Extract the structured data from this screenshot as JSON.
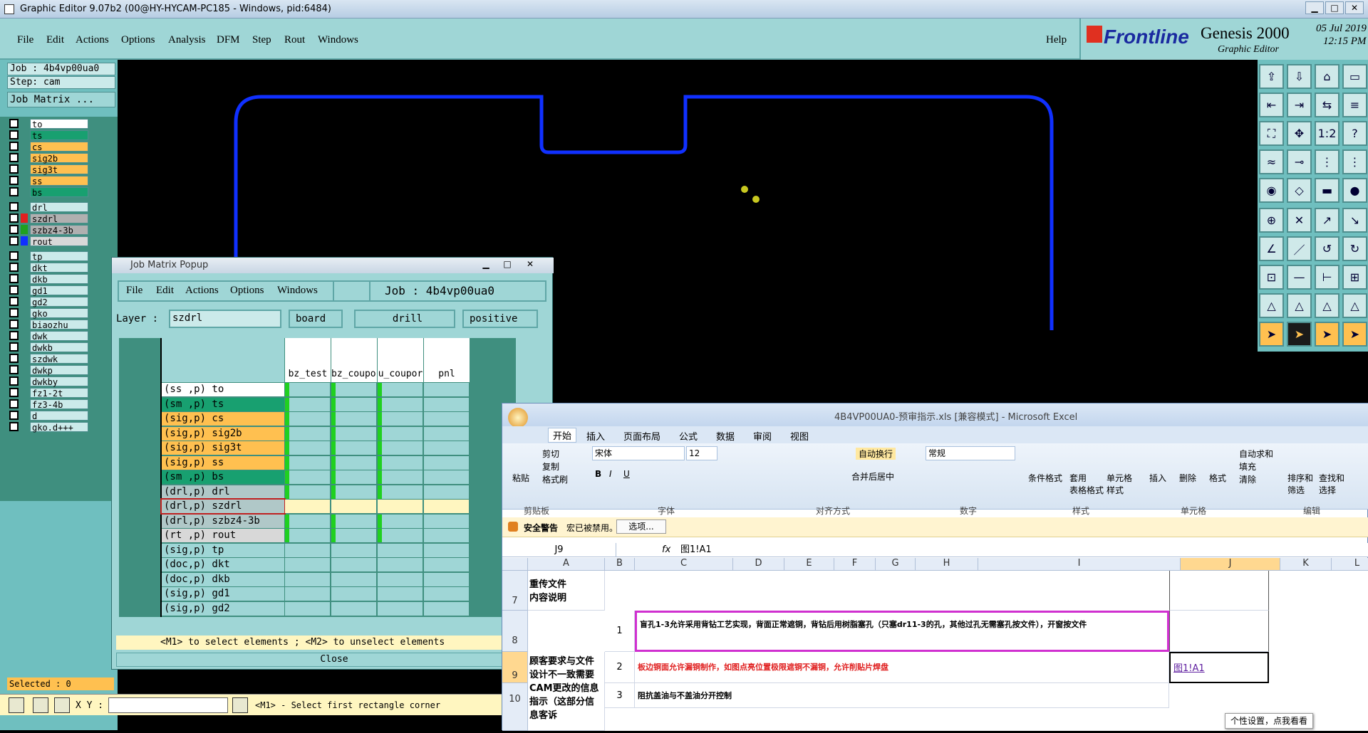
{
  "window_title": "Graphic Editor 9.07b2 (00@HY-HYCAM-PC185 - Windows, pid:6484)",
  "menu": [
    "File",
    "Edit",
    "Actions",
    "Options",
    "Analysis",
    "DFM",
    "Step",
    "Rout",
    "Windows"
  ],
  "help": "Help",
  "brand": {
    "frontline": "Frontline",
    "product": "Genesis 2000",
    "sub": "Graphic Editor",
    "date": "05 Jul 2019",
    "time": "12:15 PM"
  },
  "job_label": "Job : 4b4vp00ua0",
  "step_label": "Step: cam",
  "job_matrix_btn": "Job Matrix ...",
  "layers": [
    {
      "name": "to",
      "color": "#ffffff"
    },
    {
      "name": "ts",
      "color": "#18a070"
    },
    {
      "name": "cs",
      "color": "#ffc050"
    },
    {
      "name": "sig2b",
      "color": "#ffc050"
    },
    {
      "name": "sig3t",
      "color": "#ffc050"
    },
    {
      "name": "ss",
      "color": "#ffc050"
    },
    {
      "name": "bs",
      "color": "#18a070"
    },
    {
      "name": "drl",
      "color": "#cbeaea"
    },
    {
      "name": "szdrl",
      "color": "#b0b0b0"
    },
    {
      "name": "szbz4-3b",
      "color": "#b0b0b0"
    },
    {
      "name": "rout",
      "color": "#d8d8d8"
    },
    {
      "name": "tp",
      "color": "#cbeaea"
    },
    {
      "name": "dkt",
      "color": "#cbeaea"
    },
    {
      "name": "dkb",
      "color": "#cbeaea"
    },
    {
      "name": "gd1",
      "color": "#cbeaea"
    },
    {
      "name": "gd2",
      "color": "#cbeaea"
    },
    {
      "name": "gko",
      "color": "#cbeaea"
    },
    {
      "name": "biaozhu",
      "color": "#cbeaea"
    },
    {
      "name": "dwk",
      "color": "#cbeaea"
    },
    {
      "name": "dwkb",
      "color": "#cbeaea"
    },
    {
      "name": "szdwk",
      "color": "#cbeaea"
    },
    {
      "name": "dwkp",
      "color": "#cbeaea"
    },
    {
      "name": "dwkby",
      "color": "#cbeaea"
    },
    {
      "name": "fz1-2t",
      "color": "#cbeaea"
    },
    {
      "name": "fz3-4b",
      "color": "#cbeaea"
    },
    {
      "name": "d",
      "color": "#cbeaea"
    },
    {
      "name": "gko.d+++",
      "color": "#cbeaea"
    }
  ],
  "selected": "Selected : 0",
  "xy_label": "X Y :",
  "status_hint": "<M1> - Select first rectangle corner",
  "popup": {
    "title": "Job Matrix Popup",
    "menu": [
      "File",
      "Edit",
      "Actions",
      "Options",
      "Windows"
    ],
    "job": "Job : 4b4vp00ua0",
    "layer_label": "Layer :",
    "layer_value": "szdrl",
    "context": "board",
    "type": "drill",
    "polarity": "positive",
    "columns": [
      "bz_test",
      "bz_coupo:",
      "u_coupor",
      "pnl"
    ],
    "rows": [
      {
        "label": "(ss ,p) to",
        "color": "#ffffff"
      },
      {
        "label": "(sm ,p) ts",
        "color": "#18a070"
      },
      {
        "label": "(sig,p) cs",
        "color": "#ffc050"
      },
      {
        "label": "(sig,p) sig2b",
        "color": "#ffc050"
      },
      {
        "label": "(sig,p) sig3t",
        "color": "#ffc050"
      },
      {
        "label": "(sig,p) ss",
        "color": "#ffc050"
      },
      {
        "label": "(sm ,p) bs",
        "color": "#18a070"
      },
      {
        "label": "(drl,p) drl",
        "color": "#b0c8c8"
      },
      {
        "label": "(drl,p) szdrl",
        "color": "#b0c8c8"
      },
      {
        "label": "(drl,p) szbz4-3b",
        "color": "#b0c8c8"
      },
      {
        "label": "(rt ,p) rout",
        "color": "#d8d8d8"
      },
      {
        "label": "(sig,p) tp",
        "color": "#9fd6d6"
      },
      {
        "label": "(doc,p) dkt",
        "color": "#9fd6d6"
      },
      {
        "label": "(doc,p) dkb",
        "color": "#9fd6d6"
      },
      {
        "label": "(sig,p) gd1",
        "color": "#9fd6d6"
      },
      {
        "label": "(sig,p) gd2",
        "color": "#9fd6d6"
      }
    ],
    "hint": "<M1> to select elements ; <M2> to unselect elements",
    "close": "Close"
  },
  "excel": {
    "title": "4B4VP00UA0-预审指示.xls  [兼容模式] - Microsoft Excel",
    "tabs": [
      "开始",
      "插入",
      "页面布局",
      "公式",
      "数据",
      "审阅",
      "视图"
    ],
    "clipboard": {
      "paste": "粘贴",
      "cut": "剪切",
      "copy": "复制",
      "format": "格式刷",
      "group": "剪贴板"
    },
    "font": {
      "name": "宋体",
      "size": "12",
      "group": "字体"
    },
    "align": {
      "wrap": "自动换行",
      "merge": "合并后居中",
      "group": "对齐方式"
    },
    "number": {
      "format": "常规",
      "group": "数字"
    },
    "styles": {
      "cond": "条件格式",
      "table": "套用\n表格格式",
      "cell": "单元格\n样式",
      "group": "样式"
    },
    "cells": {
      "insert": "插入",
      "delete": "删除",
      "format": "格式",
      "group": "单元格"
    },
    "edit": {
      "autosum": "自动求和",
      "fill": "填充",
      "clear": "清除",
      "sort": "排序和\n筛选",
      "find": "查找和\n选择",
      "group": "编辑"
    },
    "security": {
      "label": "安全警告",
      "msg": "宏已被禁用。",
      "btn": "选项..."
    },
    "namebox": "J9",
    "formula": "图1!A1",
    "col_headers": [
      "A",
      "B",
      "C",
      "D",
      "E",
      "F",
      "G",
      "H",
      "I",
      "J",
      "K",
      "L"
    ],
    "row7_a": "重传文件\n内容说明",
    "row8_num": "1",
    "row8_text": "盲孔1-3允许采用背钻工艺实现，背面正常遮铜，背钻后用树脂塞孔（只塞dr11-3的孔，其他过孔无需塞孔按文件），开窗按文件",
    "row9_a": "顾客要求与文件设计不一致需要CAM更改的信息指示（这部分信息客诉",
    "row9_num": "2",
    "row9_text": "板边铜面允许漏铜制作，如图点亮位置极限遮铜不漏铜，允许削贴片焊盘",
    "row9_j": "图1!A1",
    "row10_num": "3",
    "row10_text": "阻抗盖油与不盖油分开控制",
    "tooltip": "个性设置，点我看看"
  }
}
